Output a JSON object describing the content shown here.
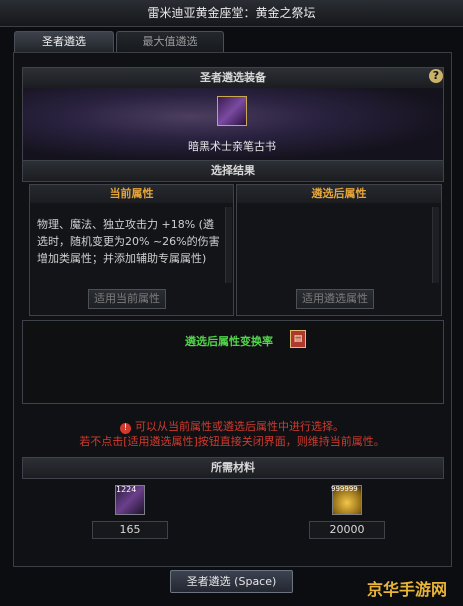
{
  "window": {
    "title": "雷米迪亚黄金座堂：黄金之祭坛"
  },
  "tabs": [
    {
      "label": "圣者遴选",
      "active": true
    },
    {
      "label": "最大值遴选",
      "active": false
    }
  ],
  "equipment_section": {
    "header": "圣者遴选装备",
    "help": "?",
    "item_name": "暗黑术士亲笔古书",
    "icon": "purple-tome-icon"
  },
  "result_section": {
    "header": "选择结果",
    "current": {
      "title": "当前属性",
      "text": "物理、魔法、独立攻击力 +18% (遴选时，随机变更为20% ~26%的伤害增加类属性；并添加辅助专属属性)",
      "button": "适用当前属性"
    },
    "after": {
      "title": "遴选后属性",
      "text": "",
      "button": "适用遴选属性"
    }
  },
  "rate": {
    "label": "遴选后属性变换率"
  },
  "warnings": {
    "line1": "可以从当前属性或遴选后属性中进行选择。",
    "line2": "若不点击[适用遴选属性]按钮直接关闭界面，则维持当前属性。"
  },
  "materials_section": {
    "header": "所需材料",
    "items": [
      {
        "icon": "purple-material-icon",
        "badge": "1224",
        "count": "165"
      },
      {
        "icon": "gold-coins-icon",
        "badge": "999999",
        "count": "20000"
      }
    ]
  },
  "action": {
    "label": "圣者遴选 (Space)"
  },
  "watermark": "京华手游网",
  "colors": {
    "title_orange": "#e4a43a",
    "rate_green": "#52d34a",
    "warning_red": "#d23a2f"
  }
}
